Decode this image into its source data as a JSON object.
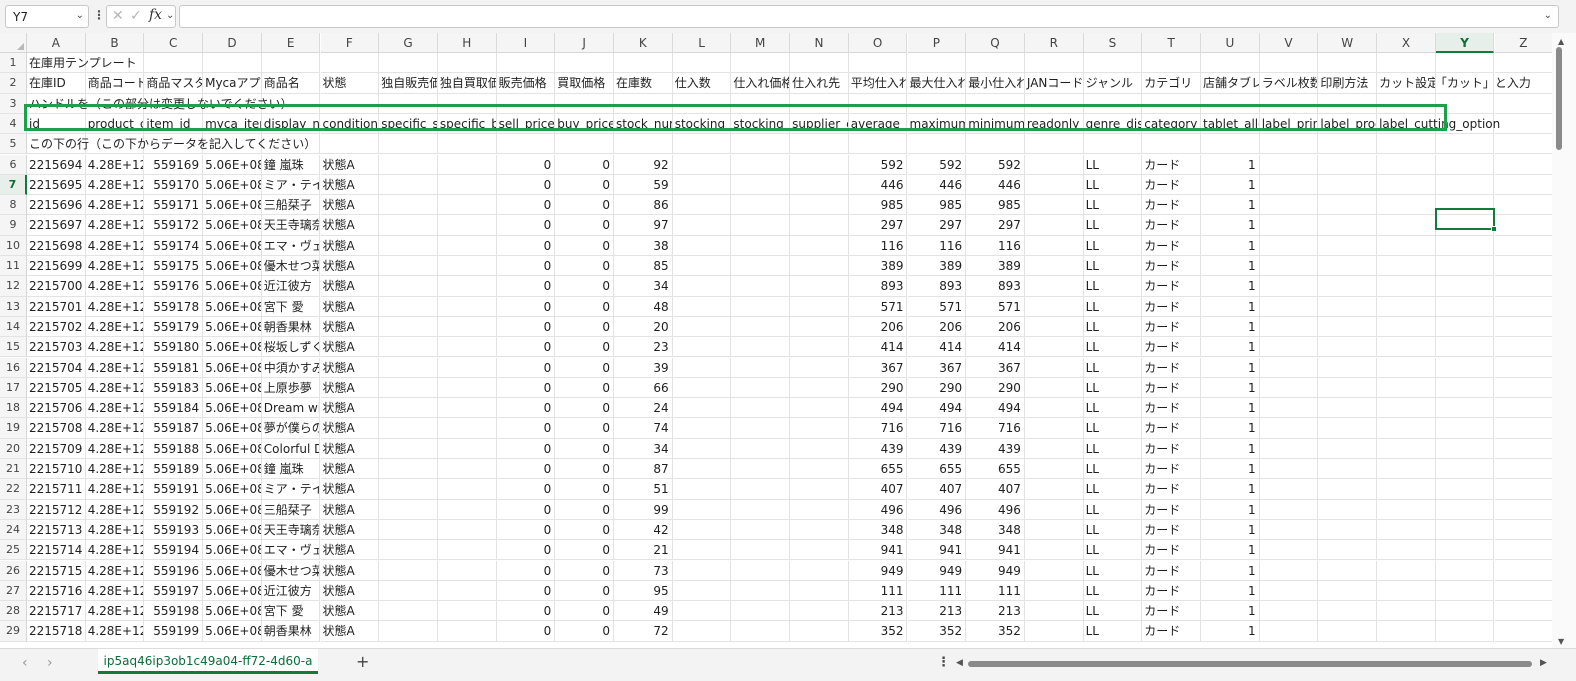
{
  "formula_bar": {
    "name_box": "Y7",
    "more_icon": "vertical-ellipsis",
    "formula": ""
  },
  "columns": [
    "A",
    "B",
    "C",
    "D",
    "E",
    "F",
    "G",
    "H",
    "I",
    "J",
    "K",
    "L",
    "M",
    "N",
    "O",
    "P",
    "Q",
    "R",
    "S",
    "T",
    "U",
    "V",
    "W",
    "X",
    "Y",
    "Z"
  ],
  "selected_column": "Y",
  "selected_row": "7",
  "row1": {
    "title": "在庫用テンプレート"
  },
  "row2": {
    "headers": [
      "在庫ID",
      "商品コード",
      "商品マスター",
      "Mycaアプ",
      "商品名",
      "状態",
      "独自販売価",
      "独自買取価",
      "販売価格",
      "買取価格",
      "在庫数",
      "仕入数",
      "仕入れ価格",
      "仕入れ先",
      "平均仕入れ",
      "最大仕入れ",
      "最小仕入れ",
      "JANコード",
      "ジャンル",
      "カテゴリ",
      "店舗タブレ",
      "ラベル枚数",
      "印刷方法",
      "カット設定"
    ],
    "note": "「カット」と入力"
  },
  "row3": {
    "text": "ハンドルを（この部分は変更しないでください）"
  },
  "row4": {
    "fields": [
      "id",
      "product_c",
      "item_id",
      "myca_item",
      "display_na",
      "condition_",
      "specific_s",
      "specific_b",
      "sell_price",
      "buy_price",
      "stock_nur",
      "stocking_i",
      "stocking_v",
      "supplier_c",
      "average_w",
      "maximum_",
      "minimum_",
      "readonly_p",
      "genre_dis",
      "category_c",
      "tablet_allo",
      "label_prin",
      "label_proc",
      "label_cutting_option"
    ]
  },
  "row5": {
    "text": "この下の行（この下からデータを記入してください）"
  },
  "data_rows": [
    [
      "2215694",
      "4.28E+12",
      "559169",
      "5.06E+08",
      "鐘 嵐珠",
      "状態A",
      "0",
      "0",
      "92",
      "592",
      "592",
      "592",
      "LL",
      "カード",
      "1"
    ],
    [
      "2215695",
      "4.28E+12",
      "559170",
      "5.06E+08",
      "ミア・テイラー",
      "状態A",
      "0",
      "0",
      "59",
      "446",
      "446",
      "446",
      "LL",
      "カード",
      "1"
    ],
    [
      "2215696",
      "4.28E+12",
      "559171",
      "5.06E+08",
      "三船栞子",
      "状態A",
      "0",
      "0",
      "86",
      "985",
      "985",
      "985",
      "LL",
      "カード",
      "1"
    ],
    [
      "2215697",
      "4.28E+12",
      "559172",
      "5.06E+08",
      "天王寺璃奈",
      "状態A",
      "0",
      "0",
      "97",
      "297",
      "297",
      "297",
      "LL",
      "カード",
      "1"
    ],
    [
      "2215698",
      "4.28E+12",
      "559174",
      "5.06E+08",
      "エマ・ヴェルデ",
      "状態A",
      "0",
      "0",
      "38",
      "116",
      "116",
      "116",
      "LL",
      "カード",
      "1"
    ],
    [
      "2215699",
      "4.28E+12",
      "559175",
      "5.06E+08",
      "優木せつ菜",
      "状態A",
      "0",
      "0",
      "85",
      "389",
      "389",
      "389",
      "LL",
      "カード",
      "1"
    ],
    [
      "2215700",
      "4.28E+12",
      "559176",
      "5.06E+08",
      "近江彼方",
      "状態A",
      "0",
      "0",
      "34",
      "893",
      "893",
      "893",
      "LL",
      "カード",
      "1"
    ],
    [
      "2215701",
      "4.28E+12",
      "559178",
      "5.06E+08",
      "宮下 愛",
      "状態A",
      "0",
      "0",
      "48",
      "571",
      "571",
      "571",
      "LL",
      "カード",
      "1"
    ],
    [
      "2215702",
      "4.28E+12",
      "559179",
      "5.06E+08",
      "朝香果林",
      "状態A",
      "0",
      "0",
      "20",
      "206",
      "206",
      "206",
      "LL",
      "カード",
      "1"
    ],
    [
      "2215703",
      "4.28E+12",
      "559180",
      "5.06E+08",
      "桜坂しずく",
      "状態A",
      "0",
      "0",
      "23",
      "414",
      "414",
      "414",
      "LL",
      "カード",
      "1"
    ],
    [
      "2215704",
      "4.28E+12",
      "559181",
      "5.06E+08",
      "中須かすみ",
      "状態A",
      "0",
      "0",
      "39",
      "367",
      "367",
      "367",
      "LL",
      "カード",
      "1"
    ],
    [
      "2215705",
      "4.28E+12",
      "559183",
      "5.06E+08",
      "上原歩夢",
      "状態A",
      "0",
      "0",
      "66",
      "290",
      "290",
      "290",
      "LL",
      "カード",
      "1"
    ],
    [
      "2215706",
      "4.28E+12",
      "559184",
      "5.06E+08",
      "Dream with",
      "状態A",
      "0",
      "0",
      "24",
      "494",
      "494",
      "494",
      "LL",
      "カード",
      "1"
    ],
    [
      "2215708",
      "4.28E+12",
      "559187",
      "5.06E+08",
      "夢が僕らの",
      "状態A",
      "0",
      "0",
      "74",
      "716",
      "716",
      "716",
      "LL",
      "カード",
      "1"
    ],
    [
      "2215709",
      "4.28E+12",
      "559188",
      "5.06E+08",
      "Colorful D",
      "状態A",
      "0",
      "0",
      "34",
      "439",
      "439",
      "439",
      "LL",
      "カード",
      "1"
    ],
    [
      "2215710",
      "4.28E+12",
      "559189",
      "5.06E+08",
      "鐘 嵐珠",
      "状態A",
      "0",
      "0",
      "87",
      "655",
      "655",
      "655",
      "LL",
      "カード",
      "1"
    ],
    [
      "2215711",
      "4.28E+12",
      "559191",
      "5.06E+08",
      "ミア・テイラー",
      "状態A",
      "0",
      "0",
      "51",
      "407",
      "407",
      "407",
      "LL",
      "カード",
      "1"
    ],
    [
      "2215712",
      "4.28E+12",
      "559192",
      "5.06E+08",
      "三船栞子",
      "状態A",
      "0",
      "0",
      "99",
      "496",
      "496",
      "496",
      "LL",
      "カード",
      "1"
    ],
    [
      "2215713",
      "4.28E+12",
      "559193",
      "5.06E+08",
      "天王寺璃奈",
      "状態A",
      "0",
      "0",
      "42",
      "348",
      "348",
      "348",
      "LL",
      "カード",
      "1"
    ],
    [
      "2215714",
      "4.28E+12",
      "559194",
      "5.06E+08",
      "エマ・ヴェルデ",
      "状態A",
      "0",
      "0",
      "21",
      "941",
      "941",
      "941",
      "LL",
      "カード",
      "1"
    ],
    [
      "2215715",
      "4.28E+12",
      "559196",
      "5.06E+08",
      "優木せつ菜",
      "状態A",
      "0",
      "0",
      "73",
      "949",
      "949",
      "949",
      "LL",
      "カード",
      "1"
    ],
    [
      "2215716",
      "4.28E+12",
      "559197",
      "5.06E+08",
      "近江彼方",
      "状態A",
      "0",
      "0",
      "95",
      "111",
      "111",
      "111",
      "LL",
      "カード",
      "1"
    ],
    [
      "2215717",
      "4.28E+12",
      "559198",
      "5.06E+08",
      "宮下 愛",
      "状態A",
      "0",
      "0",
      "49",
      "213",
      "213",
      "213",
      "LL",
      "カード",
      "1"
    ],
    [
      "2215718",
      "4.28E+12",
      "559199",
      "5.06E+08",
      "朝香果林",
      "状態A",
      "0",
      "0",
      "72",
      "352",
      "352",
      "352",
      "LL",
      "カード",
      "1"
    ]
  ],
  "sheet_tab": {
    "label": "ip5aq46ip3ob1c49a04-ff72-4d60-a"
  },
  "colors": {
    "accent": "#137a3e",
    "highlight_box": "#1ca04a"
  }
}
